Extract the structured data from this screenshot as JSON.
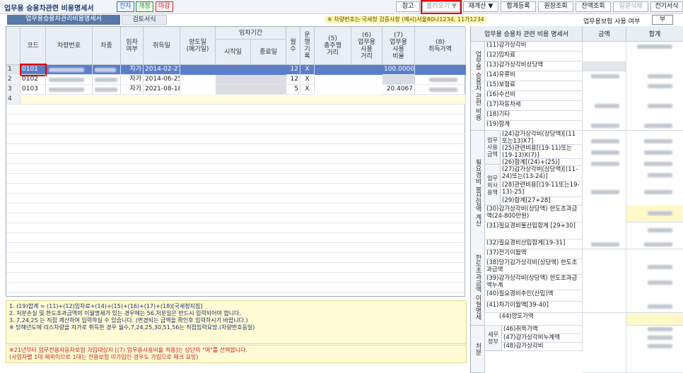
{
  "header": {
    "title": "업무용 승용차관련 비용명세서",
    "badges": [
      {
        "label": "전자",
        "color": "#2b6cc4"
      },
      {
        "label": "개정",
        "color": "#2e8b2e"
      },
      {
        "label": "마감",
        "color": "#c62828"
      }
    ],
    "buttons": [
      {
        "label": "참고"
      },
      {
        "label": "불러오기 ▼"
      },
      {
        "label": "재계산 ▼"
      },
      {
        "label": "합계등록"
      },
      {
        "label": "원장조회"
      },
      {
        "label": "잔액조회"
      },
      {
        "label": "일괄삭제"
      },
      {
        "label": "전기서식"
      }
    ]
  },
  "tabs": {
    "active": "업무용승용차관리비용명세서",
    "other": "검토서식"
  },
  "top_note": "※ 차량번호는 국세청 검증사항 (예시)서울80나1234, 11가1234",
  "insurance": {
    "label": "업무용보험 사용 여부",
    "value": "부"
  },
  "table": {
    "group_header": "임차기간",
    "headers": {
      "code": "코드",
      "car_no": "차량번호",
      "model": "차종",
      "lease": "임차\n여부",
      "acq_date": "취득일",
      "transfer_date": "양도일\n(폐기일)",
      "start": "시작일",
      "end": "종료일",
      "months": "월\n수",
      "log": "운\n행\n기\n록",
      "total_dist": "(5)\n총주행\n거리",
      "biz_dist": "(6)\n업무용\n사용\n거리",
      "biz_ratio": "(7)\n업무용\n사용\n비율",
      "acq_cost": "(8)\n취득가액"
    },
    "rows": [
      {
        "num": "1",
        "code": "0101",
        "lease": "자가",
        "acq_date": "2014-02-27",
        "months": "12",
        "log": "X",
        "ratio": "100.0000"
      },
      {
        "num": "2",
        "code": "0102",
        "lease": "자가",
        "acq_date": "2014-06-25",
        "months": "12",
        "log": "X",
        "ratio": ""
      },
      {
        "num": "3",
        "code": "0103",
        "lease": "자가",
        "acq_date": "2021-08-18",
        "months": "5",
        "log": "X",
        "ratio": "20.4067"
      },
      {
        "num": "4",
        "code": "",
        "lease": "",
        "acq_date": "",
        "months": "",
        "log": "",
        "ratio": ""
      }
    ]
  },
  "notes": [
    "1. (19)합계 = (11)+(12)임차료+(14)+(15)+(16)+(17)+(18)[국세청지침]",
    "2. 처분손실 및 한도초과금액의 이월명세가 있는 경우에는 56.처분일은 반드시 입력되어야 합니다.",
    "3. 7,24,25 는 직접 계산하여 입력하실 수 있습니다. (변경되는 금액을 확인후 입력하시기 바랍니다.)",
    "※ 당해년도에 리스차량을 자가로 취득한 경우 월수,7,24,25,30,51,56는 직접입력요망.(차량번호동일)"
  ],
  "red_notes": [
    "※21년부터 업무전용자동차보험 가입대상자 [(7) 업무용사용비율 적용]는 상단의 \"여\"를 선택합니다.",
    "(사업자별 1대 제외이므로 1대는 전용보험 미가입인 경우도 가입으로 체크 요망)"
  ],
  "right": {
    "headers": {
      "title": "업무용 승용차 관련 비용 명세서",
      "amount": "금액",
      "total": "합계"
    },
    "sections": {
      "biz_cost": "업무용 승용차 관련 비용",
      "nondeduct": "필요경비 불산입액 계산",
      "limit": "한도초과금액 이월명세",
      "disposal": "처분",
      "biz_use": "업무\n사용\n금액",
      "non_biz": "업무\n외사\n용액",
      "tax": "세무\n장부"
    },
    "items": [
      "(11)감가상각비",
      "(12)임차료",
      "(13)감가상각비상당액",
      "(14)유류비",
      "(15)보험료",
      "(16)수선비",
      "(17)자동차세",
      "(18)기타",
      "(19)합계",
      "(24)감가상각비(상당액)[(11또는13)X7]",
      "(25)관련비용[(19-11)또는(19-13)X(7)]",
      "(26)합계[(24)+(25)]",
      "(27)감가상각비(상당액)[(11-24)또는(13-24)]",
      "(28)관련비용[(19-11또는19-13)-25]",
      "(29)합계[27+28]",
      "(30)감가상각비(상당액) 한도초과금액(24-800만원)",
      "(31)필요경비불산입합계 [29+30]",
      "(32)필요경비산입합계[19-31]",
      "(37)전기이월액",
      "(38)당기감가상각비(상당액) 한도초과금액",
      "(39)감가상각비(상당액) 한도초과금액누계",
      "(40)필요경비추인(산입)액",
      "(41)차기이월액[39-40]",
      "(44)양도가액",
      "(46)취득가액",
      "(47)감가상각비누계액",
      "(48)감가상각비"
    ]
  },
  "colors": {
    "accent": "#1d3c78",
    "highlight_red": "#e00000",
    "selected_row": "#5b7ec9",
    "yellow_cell": "#fff8c8"
  }
}
